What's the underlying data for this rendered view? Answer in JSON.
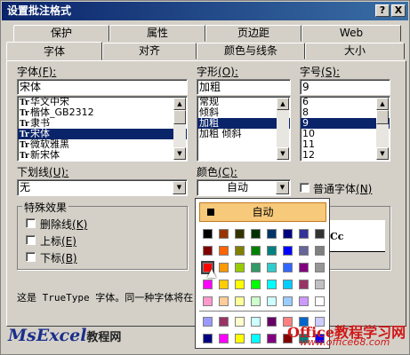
{
  "window": {
    "title": "设置批注格式",
    "help_label": "?",
    "close_label": "X"
  },
  "tabs_back": [
    "保护",
    "属性",
    "页边距",
    "Web"
  ],
  "tabs_front": [
    "字体",
    "对齐",
    "颜色与线条",
    "大小"
  ],
  "font": {
    "label": "字体",
    "accel": "(F):",
    "value": "宋体",
    "items": [
      {
        "icon": "Tr",
        "label": "华文中宋",
        "selected": false
      },
      {
        "icon": "Tr",
        "label": "楷体_GB2312",
        "selected": false
      },
      {
        "icon": "Tr",
        "label": "隶书",
        "selected": false
      },
      {
        "icon": "Tr",
        "label": "宋体",
        "selected": true
      },
      {
        "icon": "Tr",
        "label": "微软雅黑",
        "selected": false
      },
      {
        "icon": "Tr",
        "label": "新宋体",
        "selected": false
      }
    ]
  },
  "style": {
    "label": "字形",
    "accel": "(O):",
    "value": "加粗",
    "items": [
      {
        "label": "常规",
        "selected": false
      },
      {
        "label": "倾斜",
        "selected": false
      },
      {
        "label": "加粗",
        "selected": true
      },
      {
        "label": "加粗 倾斜",
        "selected": false
      }
    ]
  },
  "size": {
    "label": "字号",
    "accel": "(S):",
    "value": "9",
    "items": [
      {
        "label": "6",
        "selected": false
      },
      {
        "label": "8",
        "selected": false
      },
      {
        "label": "9",
        "selected": true
      },
      {
        "label": "10",
        "selected": false
      },
      {
        "label": "11",
        "selected": false
      },
      {
        "label": "12",
        "selected": false
      }
    ]
  },
  "underline": {
    "label": "下划线",
    "accel": "(U):",
    "value": "无"
  },
  "color": {
    "label": "颜色",
    "accel": "(C):",
    "value": "自动"
  },
  "normal_font": {
    "label": "普通字体",
    "accel": "(N)"
  },
  "effects": {
    "title": "特殊效果",
    "strike": {
      "label": "删除线",
      "accel": "(K)"
    },
    "superscript": {
      "label": "上标",
      "accel": "(E)"
    },
    "subscript": {
      "label": "下标",
      "accel": "(B)"
    }
  },
  "preview_text": "Cc",
  "info_text": "这是 TrueType 字体。同一种字体将在",
  "popup": {
    "auto_label": "自动",
    "colors": [
      [
        "#000000",
        "#993300",
        "#333300",
        "#003300",
        "#003366",
        "#000080",
        "#333399",
        "#333333"
      ],
      [
        "#800000",
        "#ff6600",
        "#808000",
        "#008000",
        "#008080",
        "#0000ff",
        "#666699",
        "#808080"
      ],
      [
        "#ff0000",
        "#ff9900",
        "#99cc00",
        "#339966",
        "#33cccc",
        "#3366ff",
        "#800080",
        "#969696"
      ],
      [
        "#ff00ff",
        "#ffcc00",
        "#ffff00",
        "#00ff00",
        "#00ffff",
        "#00ccff",
        "#993366",
        "#c0c0c0"
      ],
      [
        "#ff99cc",
        "#ffcc99",
        "#ffff99",
        "#ccffcc",
        "#ccffff",
        "#99ccff",
        "#cc99ff",
        "#ffffff"
      ]
    ],
    "colors_extra": [
      [
        "#9999ff",
        "#993366",
        "#ffffcc",
        "#ccffff",
        "#660066",
        "#ff8080",
        "#0066cc",
        "#ccccff"
      ],
      [
        "#000080",
        "#ff00ff",
        "#ffff00",
        "#00ffff",
        "#800080",
        "#800000",
        "#008080",
        "#0000ff"
      ]
    ]
  },
  "watermark": {
    "left_brand": "MsExcel",
    "left_suffix": "教程网",
    "right_brand": "Office教程学习网",
    "right_url": "www.office68.com"
  }
}
